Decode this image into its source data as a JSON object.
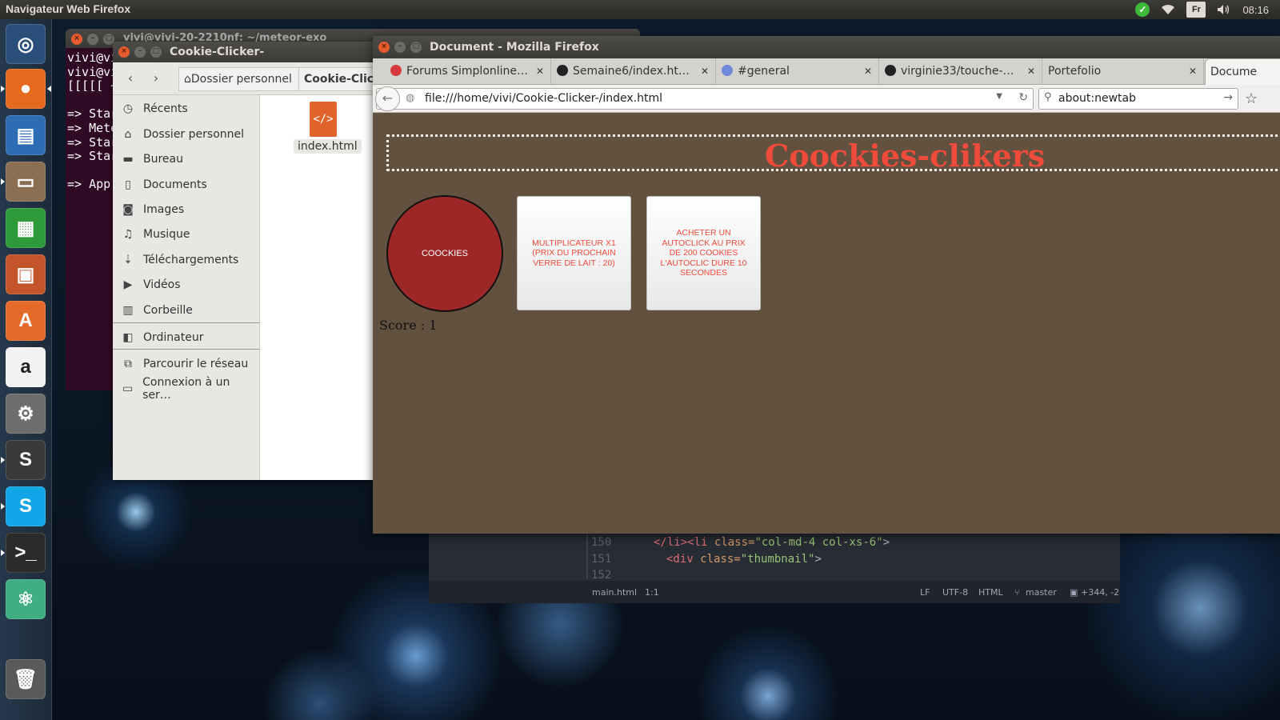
{
  "top_panel": {
    "title": "Navigateur Web Firefox",
    "keyboard_layout": "Fr",
    "clock": "08:16"
  },
  "launcher": {
    "items": [
      {
        "name": "ubuntu-dash",
        "color": "#2a4f7a",
        "glyph": "◎"
      },
      {
        "name": "firefox",
        "color": "#e66a1e",
        "glyph": "●"
      },
      {
        "name": "libreoffice-writer",
        "color": "#2d6db4",
        "glyph": "▤"
      },
      {
        "name": "files",
        "color": "#8a6f52",
        "glyph": "▭"
      },
      {
        "name": "libreoffice-calc",
        "color": "#2f9a3a",
        "glyph": "▦"
      },
      {
        "name": "libreoffice-impress",
        "color": "#c2552a",
        "glyph": "▣"
      },
      {
        "name": "software-center",
        "color": "#e46a2a",
        "glyph": "A"
      },
      {
        "name": "amazon",
        "color": "#f2f2f2",
        "glyph": "a"
      },
      {
        "name": "system-settings",
        "color": "#6d6d6d",
        "glyph": "⚙"
      },
      {
        "name": "sublime-text",
        "color": "#3a3a3a",
        "glyph": "S"
      },
      {
        "name": "skype",
        "color": "#13a6e6",
        "glyph": "S"
      },
      {
        "name": "terminal",
        "color": "#2b2b2b",
        "glyph": ">_"
      },
      {
        "name": "atom",
        "color": "#3fae82",
        "glyph": "⚛"
      },
      {
        "name": "trash",
        "color": "#5a5a5a",
        "glyph": "🗑"
      }
    ]
  },
  "terminal": {
    "title": "vivi@vivi-20-2210nf: ~/meteor-exo",
    "lines": [
      "vivi@vi",
      "vivi@vi",
      "[[[[[ ~",
      "",
      "=> Star",
      "=> Mete",
      "=> Star",
      "=> Star",
      "",
      "=> App"
    ]
  },
  "nautilus": {
    "title": "Cookie-Clicker-",
    "breadcrumb_home": "Dossier personnel",
    "breadcrumb_current": "Cookie-Clicker-",
    "sidebar": [
      {
        "label": "Récents",
        "icon": "clock-icon",
        "glyph": "◷"
      },
      {
        "label": "Dossier personnel",
        "icon": "home-icon",
        "glyph": "⌂"
      },
      {
        "label": "Bureau",
        "icon": "folder-icon",
        "glyph": "▬"
      },
      {
        "label": "Documents",
        "icon": "document-icon",
        "glyph": "▯"
      },
      {
        "label": "Images",
        "icon": "camera-icon",
        "glyph": "◙"
      },
      {
        "label": "Musique",
        "icon": "music-icon",
        "glyph": "♫"
      },
      {
        "label": "Téléchargements",
        "icon": "download-icon",
        "glyph": "⇣"
      },
      {
        "label": "Vidéos",
        "icon": "video-icon",
        "glyph": "▶"
      },
      {
        "label": "Corbeille",
        "icon": "trash-icon",
        "glyph": "▥"
      },
      {
        "label": "Ordinateur",
        "icon": "computer-icon",
        "glyph": "◧"
      },
      {
        "label": "Parcourir le réseau",
        "icon": "network-icon",
        "glyph": "⧉"
      },
      {
        "label": "Connexion à un ser…",
        "icon": "server-icon",
        "glyph": "▭"
      }
    ],
    "file": {
      "name": "index.html",
      "glyph": "</>"
    }
  },
  "editor": {
    "lines": [
      {
        "num": "150",
        "code_close": "</li>",
        "code_tag": "<li ",
        "attr": "class=",
        "value": "\"col-md-4 col-xs-6\"",
        "end": ">"
      },
      {
        "num": "151",
        "code_close": "",
        "code_tag": "<div ",
        "attr": "class=",
        "value": "\"thumbnail\"",
        "end": ">"
      },
      {
        "num": "152",
        "code_close": "",
        "code_tag": "",
        "attr": "",
        "value": "",
        "end": ""
      }
    ],
    "status": {
      "file": "main.html",
      "cursor": "1:1",
      "line_ending": "LF",
      "encoding": "UTF-8",
      "grammar": "HTML",
      "branch": "master",
      "diff": "+344, -2"
    }
  },
  "firefox": {
    "title": "Document - Mozilla Firefox",
    "tabs": [
      {
        "label": "Forums Simplonline…",
        "favicon_color": "#d43c3c",
        "icon": "forum-icon"
      },
      {
        "label": "Semaine6/index.ht…",
        "favicon_color": "#222222",
        "icon": "github-icon"
      },
      {
        "label": "#general",
        "favicon_color": "#7289da",
        "icon": "discord-icon"
      },
      {
        "label": "virginie33/touche-p…",
        "favicon_color": "#222222",
        "icon": "github-icon"
      },
      {
        "label": "Portefolio",
        "favicon_color": "",
        "icon": ""
      },
      {
        "label": "Docume",
        "favicon_color": "",
        "icon": ""
      }
    ],
    "url": "file:///home/vivi/Cookie-Clicker-/index.html",
    "search_text": "about:newtab"
  },
  "page": {
    "heading": "Coockies-clikers",
    "cookie_button": "COOCKIES",
    "multiplier_button": "MULTIPLICATEUR X1 (PRIX DU PROCHAIN VERRE DE LAIT : 20)",
    "autoclick_button": "ACHETER UN AUTOCLICK AU PRIX DE 200 COOKIES L'AUTOCLIC DURE 10 SECONDES",
    "score_label": "Score : ",
    "score_value": "1"
  },
  "colors": {
    "page_bg": "#635140",
    "heading": "#ef4b3b",
    "cookie": "#9d2727",
    "shop_text": "#ef4b3b"
  }
}
